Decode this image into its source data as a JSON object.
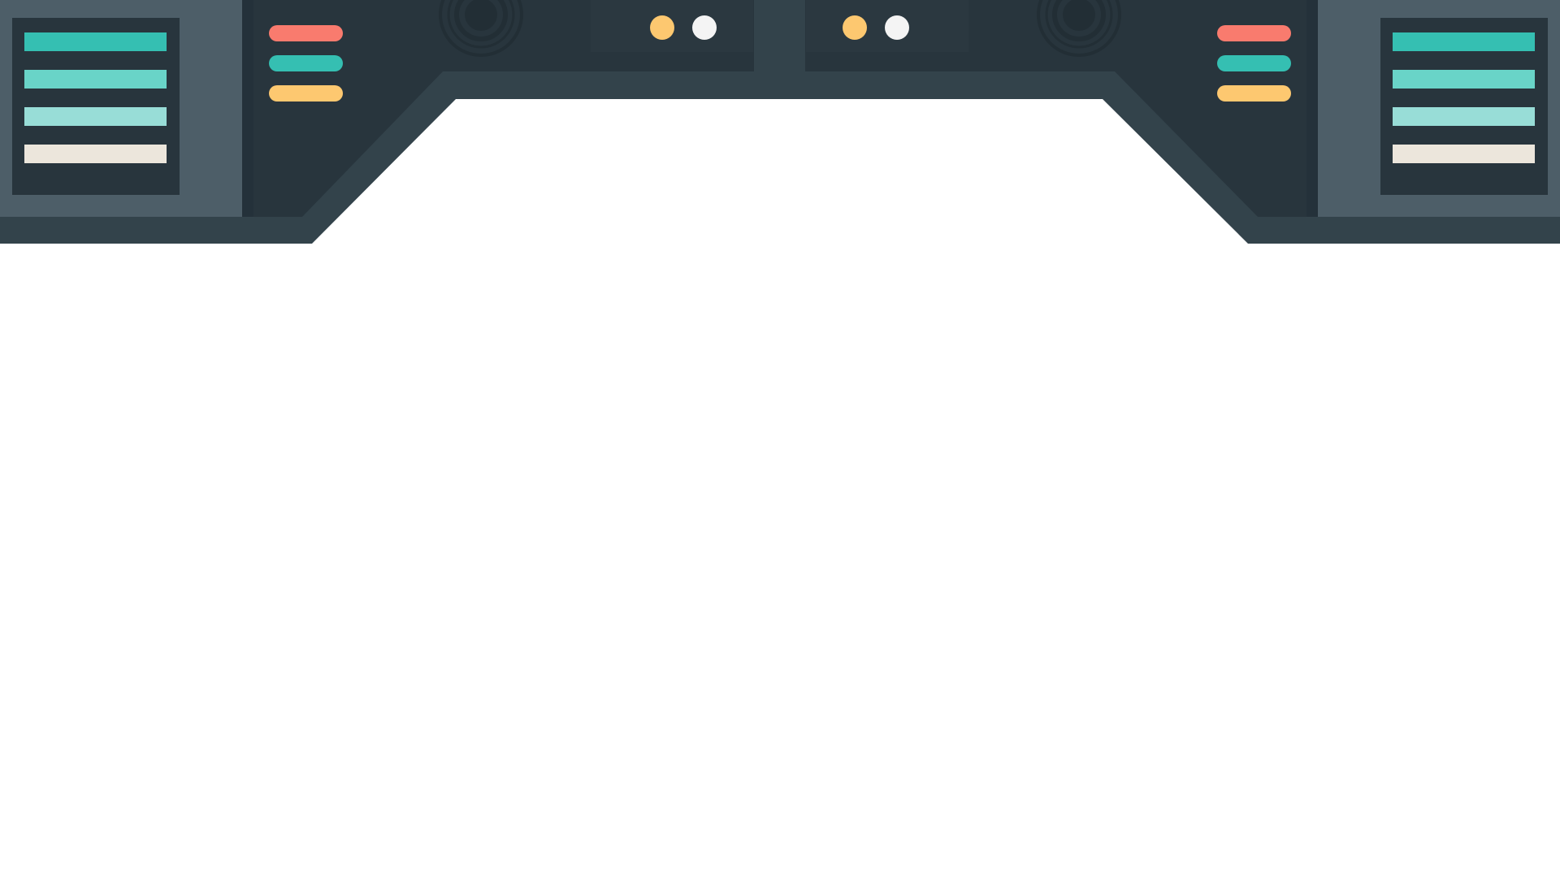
{
  "colors": {
    "page_background": "#ffffff",
    "frame": "#33434b",
    "wing_panel": "#4d5e68",
    "dark_panel": "#28353d",
    "inner_panel": "#2b3840",
    "speaker_ring": "#222e35",
    "slot_fills": [
      "#35bfb2",
      "#69d4c8",
      "#98ddd7",
      "#ece6dc"
    ],
    "pill_fills": [
      "#f97b6e",
      "#35bfb2",
      "#fdc870"
    ],
    "light_amber": "#fdc870",
    "light_white": "#f4f4f4"
  },
  "icons": {
    "speaker": "speaker-grille-icon",
    "indicator_light": "indicator-light-icon",
    "status_pill": "status-pill-icon",
    "slot_bar": "slot-bar-icon"
  }
}
